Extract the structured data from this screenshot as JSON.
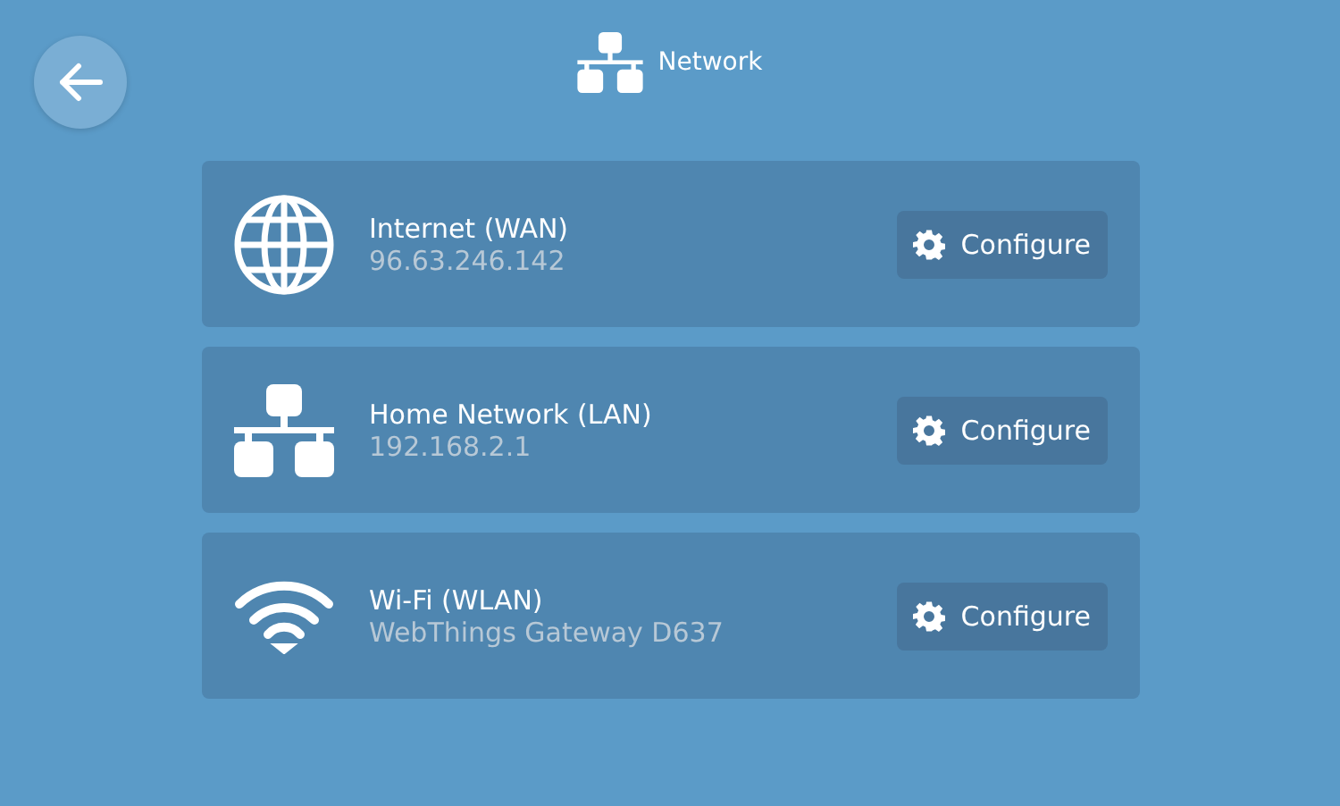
{
  "header": {
    "title": "Network"
  },
  "connections": [
    {
      "kind": "globe",
      "name": "Internet (WAN)",
      "detail": "96.63.246.142",
      "button": "Configure"
    },
    {
      "kind": "lan",
      "name": "Home Network (LAN)",
      "detail": "192.168.2.1",
      "button": "Configure"
    },
    {
      "kind": "wifi",
      "name": "Wi-Fi (WLAN)",
      "detail": "WebThings Gateway D637",
      "button": "Configure"
    }
  ]
}
